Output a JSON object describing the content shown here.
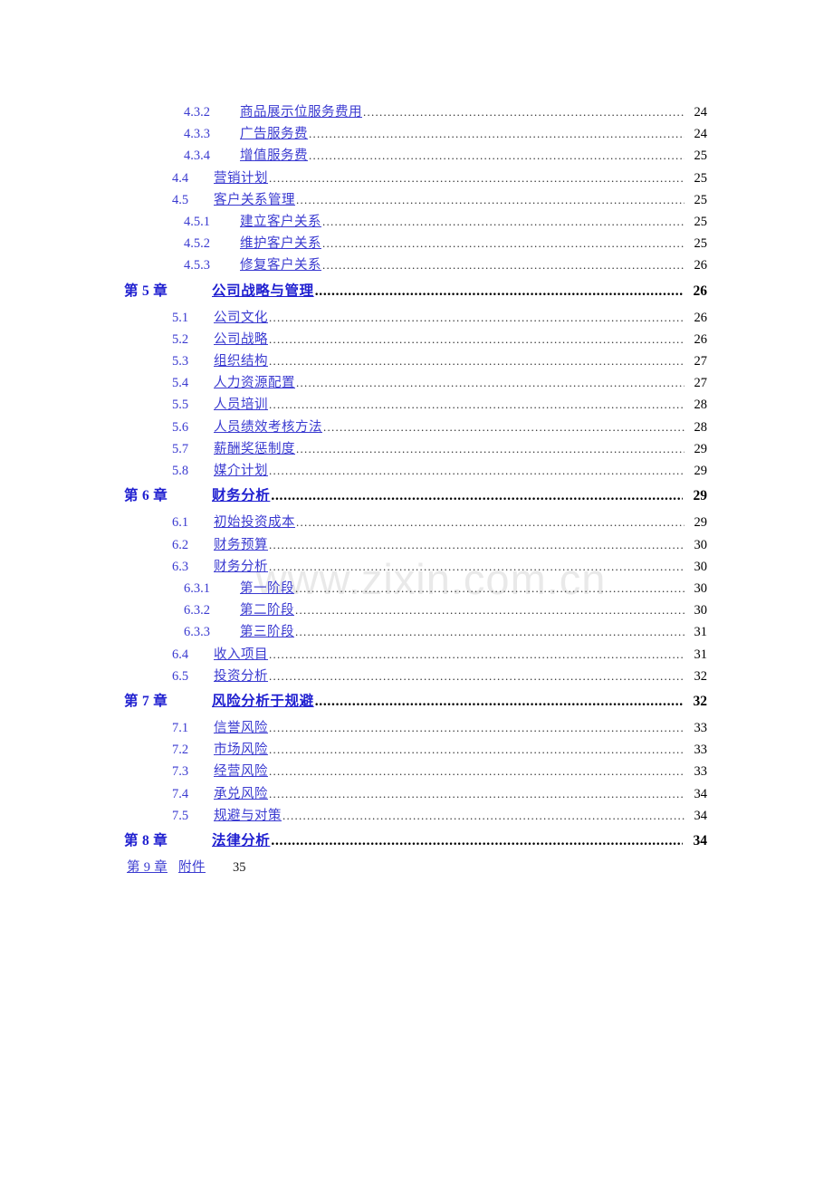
{
  "document": {
    "type": "table-of-contents",
    "language": "zh-CN",
    "watermark": "www.zixin.com.cn",
    "colors": {
      "chapter_text": "#2020d0",
      "entry_text": "#3a3ad0",
      "page_number": "#000000",
      "leader_dots": "#2b2b2b",
      "watermark": "#e9e9e9",
      "background": "#ffffff"
    }
  },
  "toc": {
    "entries": [
      {
        "level": 3,
        "number": "4.3.2",
        "title": "商品展示位服务费用",
        "page": "24"
      },
      {
        "level": 3,
        "number": "4.3.3",
        "title": "广告服务费",
        "page": "24"
      },
      {
        "level": 3,
        "number": "4.3.4",
        "title": "增值服务费",
        "page": "25"
      },
      {
        "level": 2,
        "number": "4.4",
        "title": "营销计划",
        "page": "25"
      },
      {
        "level": 2,
        "number": "4.5",
        "title": "客户关系管理",
        "page": "25"
      },
      {
        "level": 3,
        "number": "4.5.1",
        "title": "建立客户关系",
        "page": "25"
      },
      {
        "level": 3,
        "number": "4.5.2",
        "title": "维护客户关系",
        "page": "25"
      },
      {
        "level": 3,
        "number": "4.5.3",
        "title": "修复客户关系",
        "page": "26"
      },
      {
        "level": 1,
        "number": "第 5 章",
        "title": "公司战略与管理",
        "page": "26"
      },
      {
        "level": 2,
        "number": "5.1",
        "title": "公司文化",
        "page": "26"
      },
      {
        "level": 2,
        "number": "5.2",
        "title": "公司战略",
        "page": "26"
      },
      {
        "level": 2,
        "number": "5.3",
        "title": "组织结构",
        "page": "27"
      },
      {
        "level": 2,
        "number": "5.4",
        "title": "人力资源配置",
        "page": "27"
      },
      {
        "level": 2,
        "number": "5.5",
        "title": "人员培训",
        "page": "28"
      },
      {
        "level": 2,
        "number": "5.6",
        "title": "人员绩效考核方法",
        "page": "28"
      },
      {
        "level": 2,
        "number": "5.7",
        "title": "薪酬奖惩制度",
        "page": "29"
      },
      {
        "level": 2,
        "number": "5.8",
        "title": "媒介计划",
        "page": "29"
      },
      {
        "level": 1,
        "number": "第 6 章",
        "title": "财务分析",
        "page": "29"
      },
      {
        "level": 2,
        "number": "6.1",
        "title": "初始投资成本",
        "page": "29"
      },
      {
        "level": 2,
        "number": "6.2",
        "title": "财务预算",
        "page": "30"
      },
      {
        "level": 2,
        "number": "6.3",
        "title": "财务分析",
        "page": "30"
      },
      {
        "level": 3,
        "number": "6.3.1",
        "title": "第一阶段",
        "page": "30"
      },
      {
        "level": 3,
        "number": "6.3.2",
        "title": "第二阶段",
        "page": "30"
      },
      {
        "level": 3,
        "number": "6.3.3",
        "title": "第三阶段",
        "page": "31"
      },
      {
        "level": 2,
        "number": "6.4",
        "title": "收入项目",
        "page": "31"
      },
      {
        "level": 2,
        "number": "6.5",
        "title": "投资分析",
        "page": "32"
      },
      {
        "level": 1,
        "number": "第 7 章",
        "title": "风险分析于规避",
        "page": "32"
      },
      {
        "level": 2,
        "number": "7.1",
        "title": "信誉风险",
        "page": "33"
      },
      {
        "level": 2,
        "number": "7.2",
        "title": "市场风险",
        "page": "33"
      },
      {
        "level": 2,
        "number": "7.3",
        "title": "经营风险",
        "page": "33"
      },
      {
        "level": 2,
        "number": "7.4",
        "title": "承兑风险",
        "page": "34"
      },
      {
        "level": 2,
        "number": "7.5",
        "title": "规避与对策",
        "page": "34"
      },
      {
        "level": 1,
        "number": "第 8 章",
        "title": "法律分析",
        "page": "34"
      },
      {
        "level": 0,
        "number": "第 9 章",
        "title": "附件",
        "page": "35"
      }
    ]
  }
}
